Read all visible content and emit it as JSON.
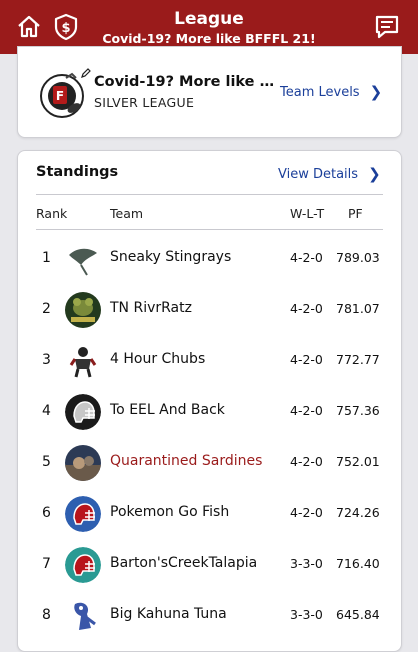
{
  "header": {
    "title": "League",
    "subtitle": "Covid-19? More like BFFFL 21!",
    "home_icon": "home-icon",
    "money_icon": "dollar-shield-icon",
    "chat_icon": "chat-icon",
    "bg_color": "#9a1b1b"
  },
  "league": {
    "name": "Covid-19? More like B...",
    "level": "SILVER LEAGUE",
    "team_levels_label": "Team Levels"
  },
  "standings": {
    "title": "Standings",
    "view_details_label": "View Details",
    "columns": {
      "rank": "Rank",
      "team": "Team",
      "wlt": "W-L-T",
      "pf": "PF"
    },
    "rows": [
      {
        "rank": "1",
        "team": "Sneaky Stingrays",
        "wlt": "4-2-0",
        "pf": "789.03",
        "avatar": "stingray-icon"
      },
      {
        "rank": "2",
        "team": "TN RivrRatz",
        "wlt": "4-2-0",
        "pf": "781.07",
        "avatar": "rat-icon"
      },
      {
        "rank": "3",
        "team": "4 Hour Chubs",
        "wlt": "4-2-0",
        "pf": "772.77",
        "avatar": "football-player-icon"
      },
      {
        "rank": "4",
        "team": "To EEL And Back",
        "wlt": "4-2-0",
        "pf": "757.36",
        "avatar": "helmet-icon"
      },
      {
        "rank": "5",
        "team": "Quarantined Sardines",
        "wlt": "4-2-0",
        "pf": "752.01",
        "avatar": "photo-avatar",
        "highlight": true
      },
      {
        "rank": "6",
        "team": "Pokemon Go Fish",
        "wlt": "4-2-0",
        "pf": "724.26",
        "avatar": "helmet-icon"
      },
      {
        "rank": "7",
        "team": "Barton'sCreekTalapia",
        "wlt": "3-3-0",
        "pf": "716.40",
        "avatar": "helmet-icon"
      },
      {
        "rank": "8",
        "team": "Big Kahuna Tuna",
        "wlt": "3-3-0",
        "pf": "645.84",
        "avatar": "cartoon-icon"
      }
    ]
  }
}
